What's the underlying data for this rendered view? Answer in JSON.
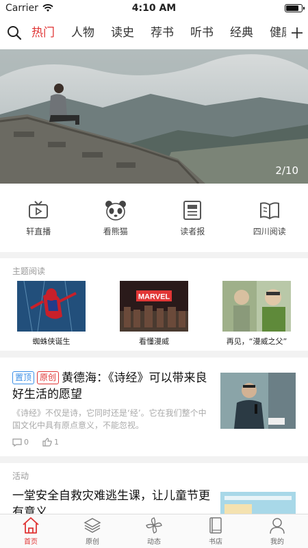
{
  "status_bar": {
    "carrier": "Carrier",
    "time": "4:10 AM",
    "battery_level": 0.85
  },
  "nav": {
    "tabs": [
      "热门",
      "人物",
      "读史",
      "荐书",
      "听书",
      "经典",
      "健康"
    ],
    "active_tab": 0,
    "add_icon": "plus-icon",
    "search_icon": "search-icon"
  },
  "banner": {
    "counter": "2/10"
  },
  "quick_actions": [
    {
      "label": "轩直播",
      "icon": "tv-icon"
    },
    {
      "label": "看熊猫",
      "icon": "panda-icon"
    },
    {
      "label": "读者报",
      "icon": "newspaper-icon"
    },
    {
      "label": "四川阅读",
      "icon": "open-book-icon"
    }
  ],
  "theme_reading": {
    "title": "主题阅读",
    "items": [
      {
        "caption": "蜘蛛侠诞生"
      },
      {
        "caption": "看懂漫威",
        "thumb_text": "MARVEL"
      },
      {
        "caption": "再见，“漫威之父”"
      }
    ]
  },
  "article": {
    "badge_top": "置顶",
    "badge_original": "原创",
    "title": "黄德海：《诗经》可以带来良好生活的愿望",
    "description": "《诗经》不仅是诗，它同时还是‘经’。它在我们整个中国文化中具有原点意义，不能忽视。",
    "comments": "0",
    "likes": "1"
  },
  "activity": {
    "section_title": "活动",
    "title": "一堂安全自救灾难逃生课，让儿童节更有意义"
  },
  "tabbar": [
    {
      "label": "首页",
      "icon": "home-icon",
      "active": true
    },
    {
      "label": "原创",
      "icon": "layers-icon",
      "active": false
    },
    {
      "label": "动态",
      "icon": "pinwheel-icon",
      "active": false
    },
    {
      "label": "书店",
      "icon": "book-icon",
      "active": false
    },
    {
      "label": "我的",
      "icon": "user-icon",
      "active": false
    }
  ],
  "colors": {
    "accent": "#e03535",
    "badge_blue": "#3a8ee6"
  }
}
